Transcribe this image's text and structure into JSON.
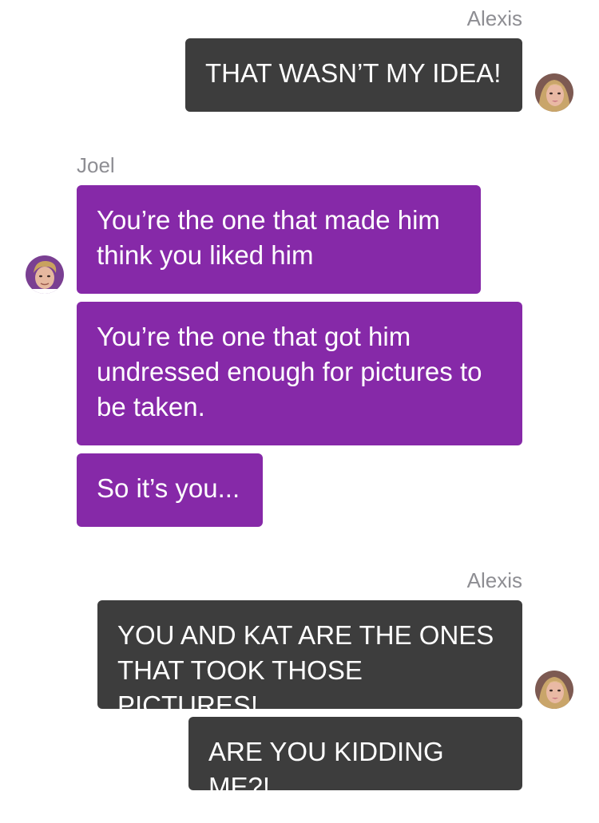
{
  "colors": {
    "outgoing_bubble": "#3d3d3d",
    "incoming_bubble": "#8629a8",
    "sender_name": "#8e8e93",
    "bubble_text": "#ffffff"
  },
  "messages": [
    {
      "sender": "Alexis",
      "side": "right",
      "avatar_icon": "alexis-avatar-icon",
      "bubbles": [
        "THAT WASN’T MY IDEA!"
      ]
    },
    {
      "sender": "Joel",
      "side": "left",
      "avatar_icon": "joel-avatar-icon",
      "bubbles": [
        "You’re the one that made him think you liked him",
        "You’re the one that got him undressed enough for pictures to be taken.",
        "So it’s you..."
      ]
    },
    {
      "sender": "Alexis",
      "side": "right",
      "avatar_icon": "alexis-avatar-icon",
      "bubbles": [
        "YOU AND KAT ARE THE ONES THAT TOOK THOSE PICTURES!",
        "ARE YOU KIDDING ME?!"
      ]
    }
  ]
}
